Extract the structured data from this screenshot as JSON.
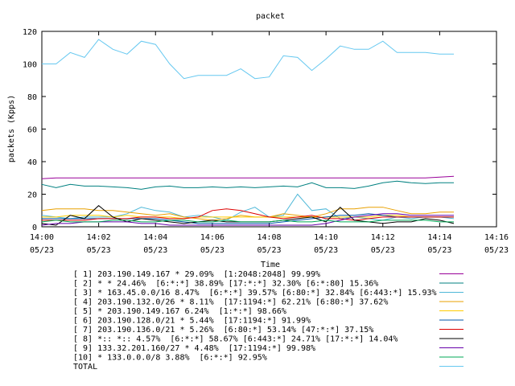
{
  "chart_data": {
    "type": "line",
    "title": "packet",
    "xlabel": "Time",
    "ylabel": "packets (Kpps)",
    "ylim": [
      0,
      120
    ],
    "xlim": [
      0,
      16
    ],
    "y_ticks": [
      "0",
      "20",
      "40",
      "60",
      "80",
      "100",
      "120"
    ],
    "x_ticks": [
      {
        "time": "14:00",
        "date": "05/23"
      },
      {
        "time": "14:02",
        "date": "05/23"
      },
      {
        "time": "14:04",
        "date": "05/23"
      },
      {
        "time": "14:06",
        "date": "05/23"
      },
      {
        "time": "14:08",
        "date": "05/23"
      },
      {
        "time": "14:10",
        "date": "05/23"
      },
      {
        "time": "14:12",
        "date": "05/23"
      },
      {
        "time": "14:14",
        "date": "05/23"
      },
      {
        "time": "14:16",
        "date": "05/23"
      }
    ],
    "grid": false,
    "legend_position": "bottom",
    "x": [
      0,
      0.5,
      1,
      1.5,
      2,
      2.5,
      3,
      3.5,
      4,
      4.5,
      5,
      5.5,
      6,
      6.5,
      7,
      7.5,
      8,
      8.5,
      9,
      9.5,
      10,
      10.5,
      11,
      11.5,
      12,
      12.5,
      13,
      13.5,
      14,
      14.5
    ],
    "series": [
      {
        "name": "[ 1] 203.190.149.167 * 29.09%  [1:2048:2048] 99.99%",
        "color": "#990099",
        "values": [
          29.5,
          30,
          30,
          30,
          30,
          30,
          30,
          30,
          30,
          30,
          30,
          30,
          30,
          30,
          30,
          30,
          30,
          30,
          30,
          30,
          30,
          30,
          30,
          30,
          30,
          30,
          30,
          30,
          30.5,
          31
        ]
      },
      {
        "name": "[ 2] * * 24.46%  [6:*:*] 38.89% [17:*:*] 32.30% [6:*:80] 15.36%",
        "color": "#008080",
        "values": [
          26,
          24,
          26,
          25,
          25,
          24.5,
          24,
          23,
          24.5,
          25,
          24,
          24,
          24.5,
          24,
          24.5,
          24,
          24.5,
          25,
          24.5,
          27,
          24,
          24,
          23.5,
          25,
          27,
          28,
          27,
          26.5,
          27,
          27
        ]
      },
      {
        "name": "[ 3] * 163.45.0.0/16 8.47%  [6:*:*] 39.57% [6:80:*] 32.84% [6:443:*] 15.93%",
        "color": "#4fb8d8",
        "values": [
          7,
          6,
          5,
          6,
          6,
          6,
          8,
          12,
          10,
          9,
          6,
          7,
          6,
          4,
          9,
          12,
          6,
          7,
          20,
          10,
          11,
          5,
          6,
          5,
          4,
          6,
          5,
          6,
          6,
          5
        ]
      },
      {
        "name": "[ 4] 203.190.132.0/26 * 8.11%  [17:1194:*] 62.21% [6:80:*] 37.62%",
        "color": "#e8a000",
        "values": [
          10,
          11,
          11,
          11,
          10,
          10,
          9,
          8,
          7,
          8,
          6,
          5,
          4,
          5,
          7,
          6,
          6,
          8,
          7,
          6,
          8,
          11,
          11,
          12,
          12,
          10,
          8,
          8,
          9,
          9
        ]
      },
      {
        "name": "[ 5] * 203.190.149.167 6.24%  [1:*:*] 98.66%",
        "color": "#ffcc00",
        "values": [
          6,
          6,
          7,
          7,
          7,
          6,
          7,
          6,
          6,
          6,
          5,
          6,
          6,
          6,
          6,
          6,
          6,
          6,
          6,
          6,
          6,
          6,
          6,
          6,
          7,
          7,
          6,
          6,
          6,
          6
        ]
      },
      {
        "name": "[ 6] 203.190.128.0/21 * 5.44%  [17:1194:*] 91.99%",
        "color": "#0055aa",
        "values": [
          5,
          5,
          5,
          5,
          5,
          5,
          5,
          5,
          5,
          4,
          3,
          2,
          2,
          2,
          2,
          2,
          2,
          3,
          4,
          5,
          6,
          7,
          7,
          8,
          7,
          6,
          6,
          6,
          6,
          6
        ]
      },
      {
        "name": "[ 7] 203.190.136.0/21 * 5.26%  [6:80:*] 53.14% [47:*:*] 37.15%",
        "color": "#dd0000",
        "values": [
          4,
          4,
          4,
          4,
          5,
          5,
          5,
          6,
          6,
          5,
          5,
          6,
          10,
          11,
          10,
          8,
          6,
          5,
          6,
          7,
          5,
          5,
          4,
          5,
          6,
          6,
          6,
          6,
          6,
          6
        ]
      },
      {
        "name": "[ 8] *:: *:: 4.57%  [6:*:*] 58.67% [6:443:*] 24.71% [17:*:*] 14.04%",
        "color": "#000000",
        "values": [
          2,
          1,
          7,
          5,
          13,
          6,
          3,
          5,
          4,
          3,
          2,
          3,
          4,
          3,
          3,
          3,
          3,
          4,
          5,
          6,
          3,
          12,
          4,
          3,
          2,
          3,
          3,
          5,
          4,
          2
        ]
      },
      {
        "name": "[ 9] 133.32.201.160/27 * 4.48%  [17:1194:*] 99.98%",
        "color": "#6600aa",
        "values": [
          1,
          2,
          2,
          3,
          3,
          3,
          3,
          2,
          2,
          1,
          1,
          1,
          1,
          1,
          1,
          1,
          1,
          1,
          1,
          1,
          2,
          4,
          6,
          7,
          8,
          8,
          7,
          7,
          7,
          7
        ]
      },
      {
        "name": "[10] * 133.0.0.0/8 3.88%  [6:*:*] 92.95%",
        "color": "#00aa55",
        "values": [
          3,
          4,
          3,
          3,
          3,
          4,
          4,
          3,
          3,
          4,
          4,
          3,
          3,
          4,
          3,
          3,
          3,
          4,
          3,
          3,
          4,
          3,
          3,
          3,
          4,
          4,
          4,
          4,
          3,
          3
        ]
      },
      {
        "name": "TOTAL",
        "color": "#66c8f0",
        "values": [
          100,
          100,
          107,
          104,
          115,
          109,
          106,
          114,
          112,
          100,
          91,
          93,
          93,
          93,
          97,
          91,
          92,
          105,
          104,
          96,
          103,
          111,
          109,
          109,
          114,
          107,
          107,
          107,
          106,
          106
        ]
      }
    ]
  }
}
